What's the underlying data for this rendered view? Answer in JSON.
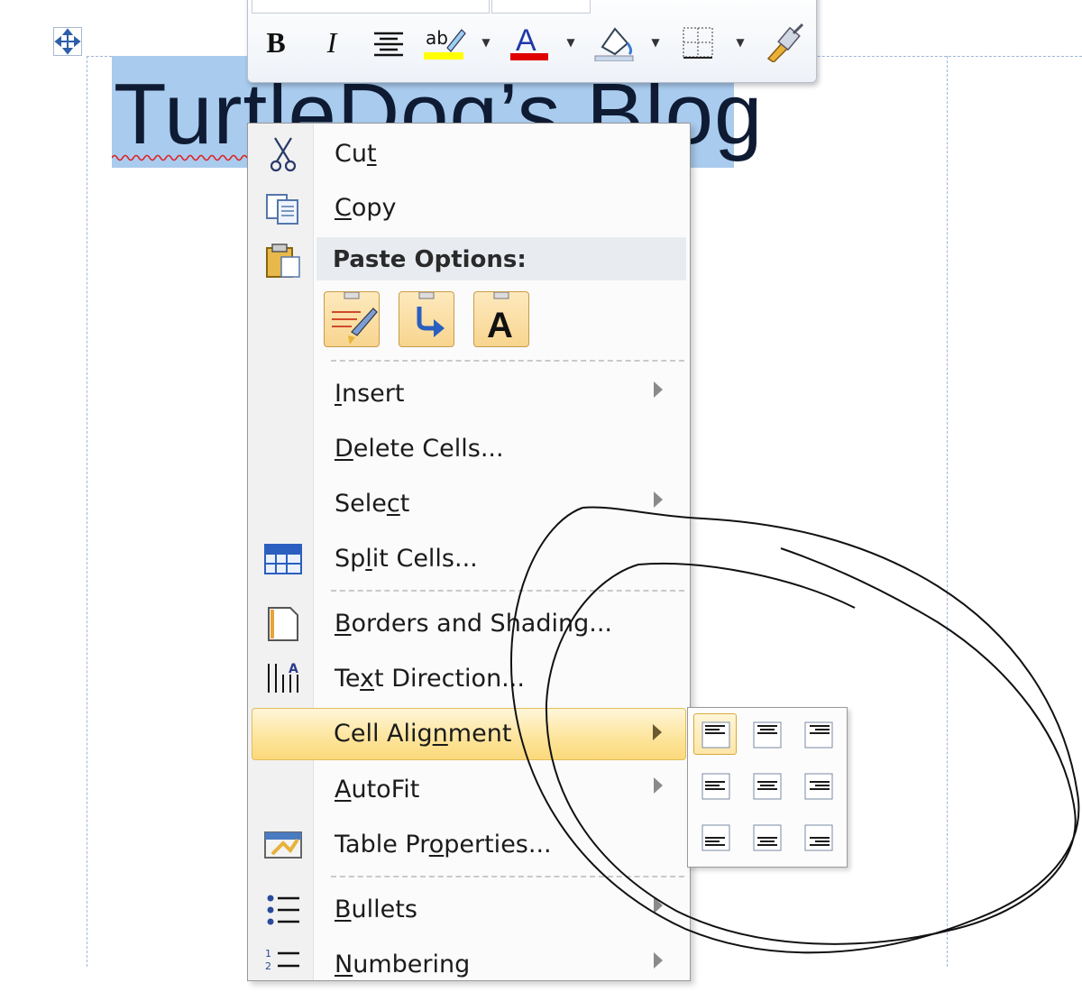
{
  "document": {
    "title_text": "TurtleDog’s Blog"
  },
  "mini_toolbar": {
    "buttons": [
      "bold-icon",
      "italic-icon",
      "center-align-icon",
      "highlight-icon",
      "font-color-icon",
      "shading-icon",
      "borders-icon",
      "format-painter-icon"
    ],
    "colors": {
      "highlight": "#ffff00",
      "font_color": "#e00000",
      "bold_glyph": "B",
      "italic_glyph": "I",
      "font_color_glyph": "A"
    }
  },
  "context_menu": {
    "cut": "Cut",
    "copy": "Copy",
    "paste_options": "Paste Options:",
    "paste_buttons": [
      "keep-source-formatting-icon",
      "merge-formatting-icon",
      "keep-text-only-icon"
    ],
    "paste_text_only_glyph": "A",
    "insert": "Insert",
    "delete_cells": "Delete Cells...",
    "select": "Select",
    "split_cells": "Split Cells...",
    "borders_and_shading": "Borders and Shading...",
    "text_direction": "Text Direction...",
    "cell_alignment": "Cell Alignment",
    "autofit": "AutoFit",
    "table_properties": "Table Properties...",
    "bullets": "Bullets",
    "numbering": "Numbering"
  },
  "cell_alignment_submenu": {
    "options": [
      "align-top-left",
      "align-top-center",
      "align-top-right",
      "align-center-left",
      "align-center-center",
      "align-center-right",
      "align-bottom-left",
      "align-bottom-center",
      "align-bottom-right"
    ],
    "selected": "align-top-left",
    "highlight_color": "#fde49a"
  }
}
